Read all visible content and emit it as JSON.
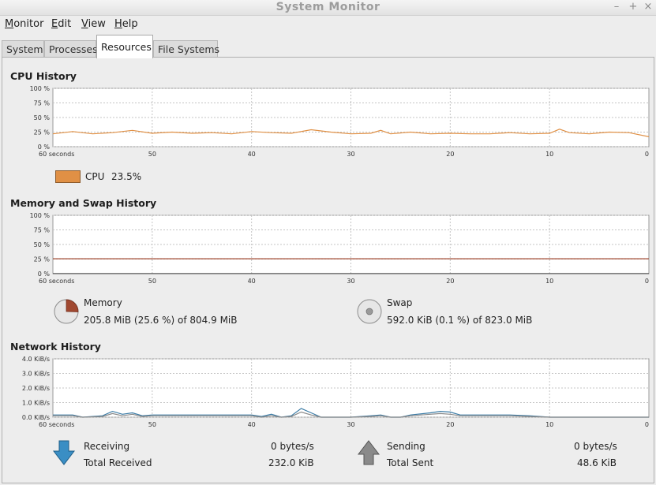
{
  "window": {
    "title": "System Monitor",
    "minimize": "–",
    "maximize": "+",
    "close": "×"
  },
  "menu": {
    "items": [
      {
        "mnemonic": "M",
        "rest": "onitor"
      },
      {
        "mnemonic": "E",
        "rest": "dit"
      },
      {
        "mnemonic": "V",
        "rest": "iew"
      },
      {
        "mnemonic": "H",
        "rest": "elp"
      }
    ]
  },
  "tabs": [
    {
      "label": "System",
      "active": false
    },
    {
      "label": "Processes",
      "active": false
    },
    {
      "label": "Resources",
      "active": true
    },
    {
      "label": "File Systems",
      "active": false
    }
  ],
  "colors": {
    "cpu": "#e09045",
    "network": "#3c7ca6",
    "memory_fill": "#a04830",
    "grid": "#c8c8c8",
    "receive_arrow": "#3a8ec4",
    "send_arrow": "#8a8a8a"
  },
  "cpu": {
    "title": "CPU History",
    "label": "CPU",
    "value": "23.5%"
  },
  "memory": {
    "title": "Memory and Swap History",
    "memory_label": "Memory",
    "memory_value": "205.8 MiB (25.6 %) of 804.9 MiB",
    "memory_fraction": 0.256,
    "swap_label": "Swap",
    "swap_value": "592.0 KiB (0.1 %) of 823.0 MiB",
    "swap_fraction": 0.001
  },
  "network": {
    "title": "Network History",
    "receiving_label": "Receiving",
    "receiving_value": "0 bytes/s",
    "total_received_label": "Total Received",
    "total_received_value": "232.0 KiB",
    "sending_label": "Sending",
    "sending_value": "0 bytes/s",
    "total_sent_label": "Total Sent",
    "total_sent_value": "48.6 KiB"
  },
  "chart_data": [
    {
      "type": "line",
      "name": "cpu-history",
      "yticks": [
        "100 %",
        "75 %",
        "50 %",
        "25 %",
        "0 %"
      ],
      "ylim": [
        0,
        100
      ],
      "xticks": [
        "60 seconds",
        "50",
        "40",
        "30",
        "20",
        "10",
        "0"
      ],
      "xlim": [
        60,
        0
      ],
      "grid": true,
      "series": [
        {
          "name": "CPU",
          "x": [
            60,
            58,
            56,
            54,
            52,
            50,
            48,
            46,
            44,
            42,
            40,
            38,
            36,
            34,
            32,
            30,
            28,
            27,
            26,
            24,
            22,
            20,
            18,
            16,
            14,
            12,
            10,
            9,
            8,
            6,
            4,
            2,
            0
          ],
          "y": [
            22,
            26,
            22,
            24,
            28,
            23,
            25,
            23,
            24,
            22,
            26,
            24,
            23,
            29,
            25,
            22,
            23,
            28,
            22,
            25,
            22,
            23,
            22,
            22,
            24,
            22,
            23,
            30,
            24,
            22,
            25,
            24,
            17
          ]
        }
      ]
    },
    {
      "type": "line",
      "name": "memory-swap-history",
      "yticks": [
        "100 %",
        "75 %",
        "50 %",
        "25 %",
        "0 %"
      ],
      "ylim": [
        0,
        100
      ],
      "xticks": [
        "60 seconds",
        "50",
        "40",
        "30",
        "20",
        "10",
        "0"
      ],
      "xlim": [
        60,
        0
      ],
      "grid": true,
      "series": [
        {
          "name": "Memory",
          "x": [
            60,
            0
          ],
          "y": [
            25.6,
            25.6
          ]
        },
        {
          "name": "Swap",
          "x": [
            60,
            0
          ],
          "y": [
            0.1,
            0.1
          ]
        }
      ]
    },
    {
      "type": "line",
      "name": "network-history",
      "yticks": [
        "4.0 KiB/s",
        "3.0 KiB/s",
        "2.0 KiB/s",
        "1.0 KiB/s",
        "0.0 KiB/s"
      ],
      "ylim": [
        0,
        4
      ],
      "xticks": [
        "60 seconds",
        "50",
        "40",
        "30",
        "20",
        "10",
        "0"
      ],
      "xlim": [
        60,
        0
      ],
      "grid": true,
      "series": [
        {
          "name": "Receiving",
          "x": [
            60,
            58,
            57,
            55,
            54,
            53,
            52,
            51,
            50,
            45,
            40,
            39,
            38,
            37,
            36,
            35,
            34,
            33,
            32,
            30,
            28,
            27,
            26,
            25,
            24,
            22,
            21,
            20,
            19,
            18,
            16,
            14,
            12,
            10,
            5,
            0
          ],
          "y": [
            0.15,
            0.15,
            0.0,
            0.1,
            0.4,
            0.2,
            0.3,
            0.1,
            0.15,
            0.15,
            0.15,
            0.05,
            0.2,
            0.0,
            0.1,
            0.6,
            0.3,
            0.0,
            0.0,
            0.0,
            0.1,
            0.15,
            0.0,
            0.0,
            0.15,
            0.3,
            0.4,
            0.35,
            0.15,
            0.15,
            0.15,
            0.15,
            0.1,
            0.0,
            0.0,
            0.0
          ]
        },
        {
          "name": "Sending",
          "x": [
            60,
            58,
            57,
            55,
            54,
            53,
            52,
            51,
            50,
            45,
            40,
            39,
            38,
            37,
            36,
            35,
            34,
            33,
            32,
            30,
            28,
            27,
            26,
            25,
            24,
            22,
            21,
            20,
            19,
            18,
            16,
            14,
            12,
            10,
            5,
            0
          ],
          "y": [
            0.1,
            0.1,
            0.0,
            0.05,
            0.25,
            0.1,
            0.2,
            0.05,
            0.1,
            0.1,
            0.1,
            0.0,
            0.1,
            0.0,
            0.05,
            0.35,
            0.15,
            0.0,
            0.0,
            0.0,
            0.05,
            0.1,
            0.0,
            0.0,
            0.1,
            0.2,
            0.25,
            0.2,
            0.1,
            0.1,
            0.1,
            0.1,
            0.05,
            0.0,
            0.0,
            0.0
          ]
        }
      ]
    }
  ]
}
